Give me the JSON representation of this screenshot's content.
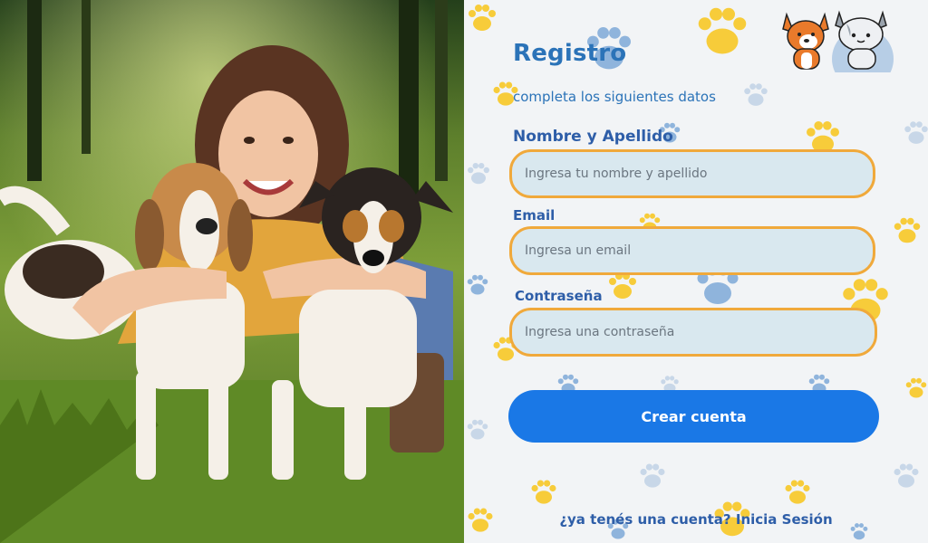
{
  "form": {
    "title": "Registro",
    "subtitle": "completa los siguientes datos",
    "fields": [
      {
        "label": "Nombre y Apellido",
        "placeholder": "Ingresa tu nombre y apellido",
        "value": ""
      },
      {
        "label": "Email",
        "placeholder": "Ingresa un email",
        "value": ""
      },
      {
        "label": "Contraseña",
        "placeholder": "Ingresa una contraseña",
        "value": ""
      }
    ],
    "submit_label": "Crear cuenta",
    "login_prompt": "¿ya tenés una cuenta?",
    "login_link": "Inicia Sesión"
  },
  "colors": {
    "brand_blue": "#1a78e6",
    "heading_blue": "#2b73b8",
    "field_border": "#f0a93b",
    "field_bg": "#d9e8ef",
    "paw_yellow": "#f7cc3a",
    "paw_blue": "#8fb4dc",
    "panel_bg": "#f2f4f6"
  },
  "icons": {
    "mascot_left": "dog-mascot-icon",
    "mascot_right": "cat-mascot-icon",
    "background_pattern": "paw-print-icon"
  }
}
